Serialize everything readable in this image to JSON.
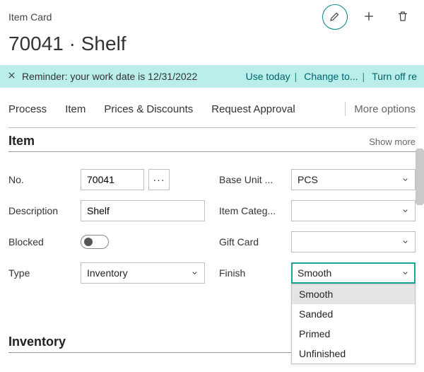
{
  "breadcrumb": "Item Card",
  "title": "70041 · Shelf",
  "notification": {
    "text": "Reminder: your work date is 12/31/2022",
    "actions": {
      "use_today": "Use today",
      "change_to": "Change to...",
      "turn_off": "Turn off re"
    }
  },
  "tabs": {
    "process": "Process",
    "item": "Item",
    "prices": "Prices & Discounts",
    "request": "Request Approval",
    "more": "More options"
  },
  "section_item": {
    "heading": "Item",
    "show_more": "Show more",
    "fields": {
      "no": {
        "label": "No.",
        "value": "70041"
      },
      "description": {
        "label": "Description",
        "value": "Shelf"
      },
      "blocked": {
        "label": "Blocked"
      },
      "type": {
        "label": "Type",
        "value": "Inventory"
      },
      "base_unit": {
        "label": "Base Unit ...",
        "value": "PCS"
      },
      "item_categ": {
        "label": "Item Categ...",
        "value": ""
      },
      "gift_card": {
        "label": "Gift Card",
        "value": ""
      },
      "finish": {
        "label": "Finish",
        "value": "Smooth",
        "options": [
          "Smooth",
          "Sanded",
          "Primed",
          "Unfinished"
        ]
      }
    }
  },
  "section_inventory": {
    "heading": "Inventory"
  }
}
